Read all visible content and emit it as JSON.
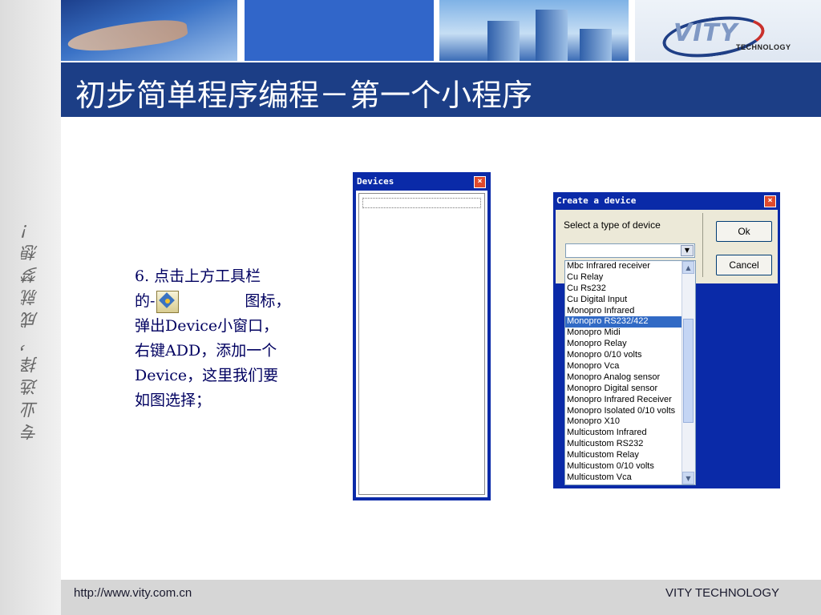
{
  "slogan": "专业选择，成就梦想！",
  "banner": {
    "logo_text": "VITY",
    "logo_sub": "TECHNOLOGY"
  },
  "title": "初步简单程序编程－第一个小程序",
  "description": {
    "line1": "6. 点击上方工具栏",
    "line2_pre": "的-",
    "line2_post": "图标，",
    "line3": "弹出Device小窗口，",
    "line4": "右键ADD，添加一个",
    "line5": "Device，这里我们要",
    "line6": "如图选择；",
    "icon": "device-toolbar-icon"
  },
  "devices_window": {
    "title": "Devices",
    "close": "×"
  },
  "create_dialog": {
    "title": "Create a device",
    "close": "×",
    "label": "Select a type of device",
    "ok": "Ok",
    "cancel": "Cancel",
    "selected_index": 5,
    "items": [
      "Mbc Infrared receiver",
      "Cu Relay",
      "Cu Rs232",
      "Cu Digital Input",
      "Monopro Infrared",
      "Monopro RS232/422",
      "Monopro Midi",
      "Monopro Relay",
      "Monopro 0/10 volts",
      "Monopro Vca",
      "Monopro Analog sensor",
      "Monopro Digital sensor",
      "Monopro Infrared Receiver",
      "Monopro Isolated 0/10 volts",
      "Monopro X10",
      "Multicustom Infrared",
      "Multicustom RS232",
      "Multicustom Relay",
      "Multicustom 0/10 volts",
      "Multicustom Vca"
    ]
  },
  "footer": {
    "url": "http://www.vity.com.cn",
    "brand": "VITY TECHNOLOGY"
  }
}
